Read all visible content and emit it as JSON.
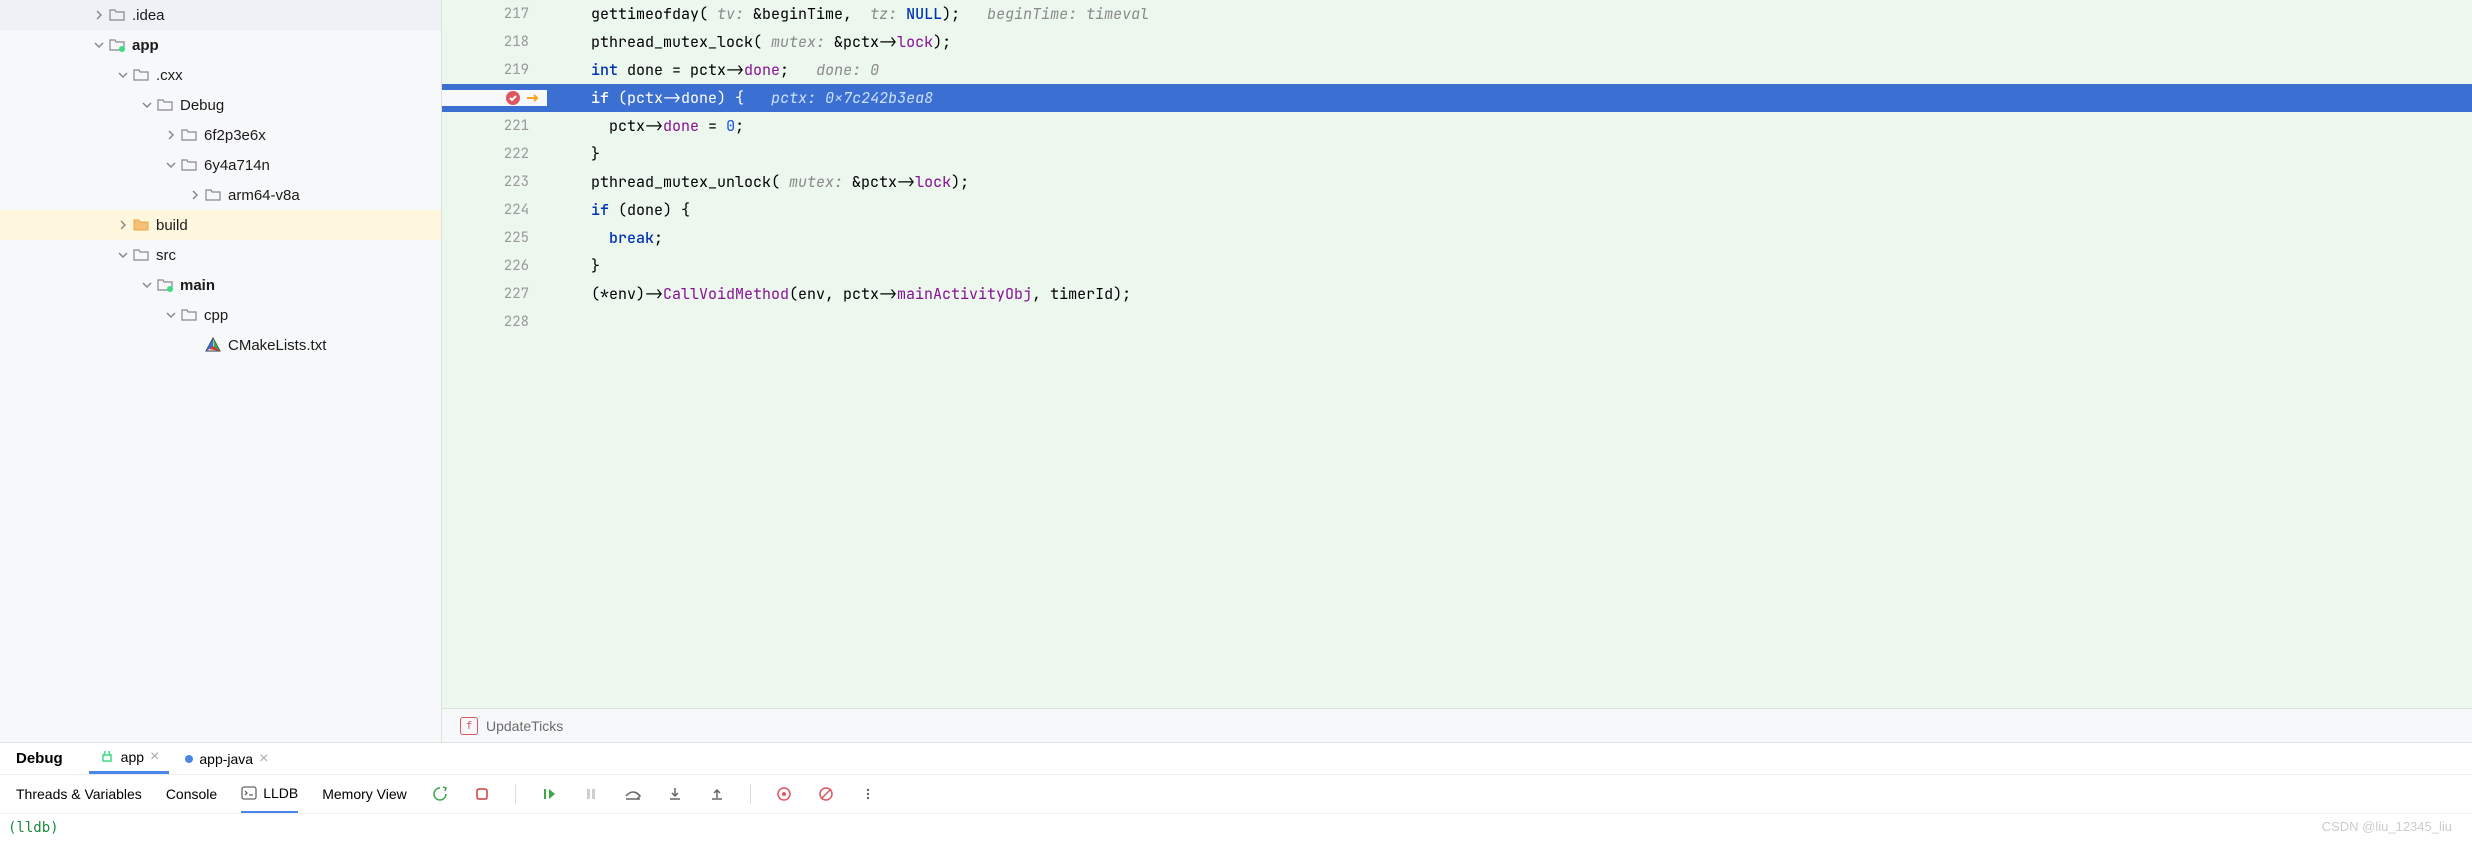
{
  "tree": {
    "idea": ".idea",
    "app": "app",
    "cxx": ".cxx",
    "debug": "Debug",
    "hash1": "6f2p3e6x",
    "hash2": "6y4a714n",
    "arm": "arm64-v8a",
    "build": "build",
    "src": "src",
    "main": "main",
    "cpp": "cpp",
    "cmake": "CMakeLists.txt"
  },
  "code": {
    "lines": {
      "217": {
        "n": "217"
      },
      "218": {
        "n": "218"
      },
      "219": {
        "n": "219"
      },
      "220": {
        "n": ""
      },
      "221": {
        "n": "221"
      },
      "222": {
        "n": "222"
      },
      "223": {
        "n": "223"
      },
      "224": {
        "n": "224"
      },
      "225": {
        "n": "225"
      },
      "226": {
        "n": "226"
      },
      "227": {
        "n": "227"
      },
      "228": {
        "n": "228"
      }
    },
    "l217_fn": "gettimeofday",
    "l217_p1": "tv: ",
    "l217_a1": "&beginTime,  ",
    "l217_p2": "tz: ",
    "l217_a2": "NULL",
    "l217_e": ");   ",
    "l217_h": "beginTime: timeval",
    "l218_fn": "pthread_mutex_lock",
    "l218_p": "mutex: ",
    "l218_a": "&pctx->",
    "l218_prop": "lock",
    "l218_e": ");",
    "l219_kw": "int",
    "l219_a": " done = pctx->",
    "l219_prop": "done",
    "l219_e": ";   ",
    "l219_h": "done: 0",
    "l220_kw": "if",
    "l220_a": " (pctx->",
    "l220_prop": "done",
    "l220_e": ") {   ",
    "l220_h": "pctx: 0x7c242b3ea8",
    "l221_a": "pctx->",
    "l221_prop": "done",
    "l221_e": " = ",
    "l221_num": "0",
    "l221_f": ";",
    "l222": "}",
    "l223_fn": "pthread_mutex_unlock",
    "l223_p": "mutex: ",
    "l223_a": "&pctx->",
    "l223_prop": "lock",
    "l223_e": ");",
    "l224_kw": "if",
    "l224_a": " (done) {",
    "l225_kw": "break",
    "l225_e": ";",
    "l226": "}",
    "l227_a": "(*env)->",
    "l227_fn": "CallVoidMethod",
    "l227_b": "(env, pctx->",
    "l227_prop": "mainActivityObj",
    "l227_c": ", timerId);"
  },
  "breadcrumb": {
    "fn": "UpdateTicks"
  },
  "debug": {
    "title": "Debug",
    "tab_app": "app",
    "tab_app_java": "app-java",
    "threads": "Threads & Variables",
    "console": "Console",
    "lldb": "LLDB",
    "memory": "Memory View",
    "prompt": "(lldb) "
  },
  "watermark": "CSDN @liu_12345_liu"
}
